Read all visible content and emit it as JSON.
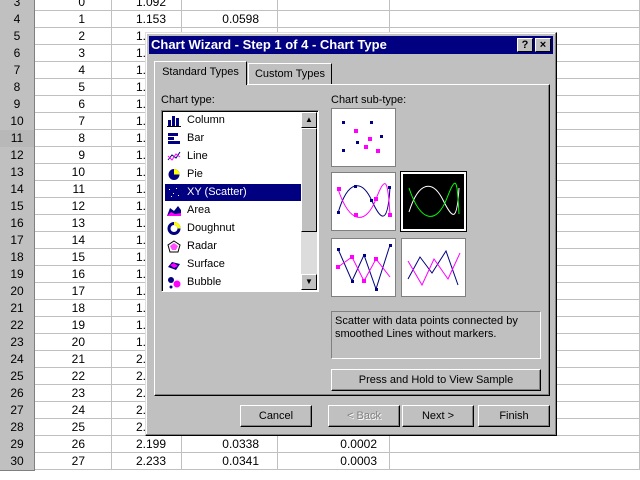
{
  "sheet": {
    "rows": [
      {
        "n": "3",
        "a": "0",
        "b": "1.092",
        "c": "",
        "d": ""
      },
      {
        "n": "4",
        "a": "1",
        "b": "1.153",
        "c": "0.0598",
        "d": ""
      },
      {
        "n": "5",
        "a": "2",
        "b": "1.",
        "c": "",
        "d": ""
      },
      {
        "n": "6",
        "a": "3",
        "b": "1.",
        "c": "",
        "d": ""
      },
      {
        "n": "7",
        "a": "4",
        "b": "1.",
        "c": "",
        "d": ""
      },
      {
        "n": "8",
        "a": "5",
        "b": "1.",
        "c": "",
        "d": ""
      },
      {
        "n": "9",
        "a": "6",
        "b": "1.",
        "c": "",
        "d": ""
      },
      {
        "n": "10",
        "a": "7",
        "b": "1.",
        "c": "",
        "d": ""
      },
      {
        "n": "11",
        "a": "8",
        "b": "1.",
        "c": "",
        "d": ""
      },
      {
        "n": "12",
        "a": "9",
        "b": "1.",
        "c": "",
        "d": ""
      },
      {
        "n": "13",
        "a": "10",
        "b": "1.",
        "c": "",
        "d": ""
      },
      {
        "n": "14",
        "a": "11",
        "b": "1.",
        "c": "",
        "d": ""
      },
      {
        "n": "15",
        "a": "12",
        "b": "1.",
        "c": "",
        "d": ""
      },
      {
        "n": "16",
        "a": "13",
        "b": "1.",
        "c": "",
        "d": ""
      },
      {
        "n": "17",
        "a": "14",
        "b": "1.",
        "c": "",
        "d": ""
      },
      {
        "n": "18",
        "a": "15",
        "b": "1.",
        "c": "",
        "d": ""
      },
      {
        "n": "19",
        "a": "16",
        "b": "1.",
        "c": "",
        "d": ""
      },
      {
        "n": "20",
        "a": "17",
        "b": "1.",
        "c": "",
        "d": ""
      },
      {
        "n": "21",
        "a": "18",
        "b": "1.",
        "c": "",
        "d": ""
      },
      {
        "n": "22",
        "a": "19",
        "b": "1.",
        "c": "",
        "d": ""
      },
      {
        "n": "23",
        "a": "20",
        "b": "1.",
        "c": "",
        "d": ""
      },
      {
        "n": "24",
        "a": "21",
        "b": "2.",
        "c": "",
        "d": ""
      },
      {
        "n": "25",
        "a": "22",
        "b": "2.",
        "c": "",
        "d": ""
      },
      {
        "n": "26",
        "a": "23",
        "b": "2.",
        "c": "",
        "d": ""
      },
      {
        "n": "27",
        "a": "24",
        "b": "2.",
        "c": "",
        "d": ""
      },
      {
        "n": "28",
        "a": "25",
        "b": "2.",
        "c": "",
        "d": ""
      },
      {
        "n": "29",
        "a": "26",
        "b": "2.199",
        "c": "0.0338",
        "d": "0.0002"
      },
      {
        "n": "30",
        "a": "27",
        "b": "2.233",
        "c": "0.0341",
        "d": "0.0003"
      }
    ],
    "active_row": "11"
  },
  "dialog": {
    "title": "Chart Wizard - Step 1 of 4 - Chart Type",
    "help_btn": "?",
    "close_btn": "×",
    "tabs": {
      "standard": "Standard Types",
      "custom": "Custom Types"
    },
    "chart_type_label": "Chart type:",
    "chart_subtype_label": "Chart sub-type:",
    "chart_types": [
      {
        "label": "Column",
        "icon": "column-chart-icon"
      },
      {
        "label": "Bar",
        "icon": "bar-chart-icon"
      },
      {
        "label": "Line",
        "icon": "line-chart-icon"
      },
      {
        "label": "Pie",
        "icon": "pie-chart-icon"
      },
      {
        "label": "XY (Scatter)",
        "icon": "scatter-chart-icon",
        "selected": true
      },
      {
        "label": "Area",
        "icon": "area-chart-icon"
      },
      {
        "label": "Doughnut",
        "icon": "doughnut-chart-icon"
      },
      {
        "label": "Radar",
        "icon": "radar-chart-icon"
      },
      {
        "label": "Surface",
        "icon": "surface-chart-icon"
      },
      {
        "label": "Bubble",
        "icon": "bubble-chart-icon"
      }
    ],
    "description": "Scatter with data points connected by smoothed Lines without markers.",
    "preview_btn": "Press and Hold to View Sample",
    "cancel_btn": "Cancel",
    "back_btn": "< Back",
    "next_btn": "Next >",
    "finish_btn": "Finish",
    "colors": {
      "title_bar": "#000080",
      "face": "#c0c0c0",
      "marker": "#ff00ff",
      "navy": "#000080",
      "green": "#00ff00"
    }
  }
}
